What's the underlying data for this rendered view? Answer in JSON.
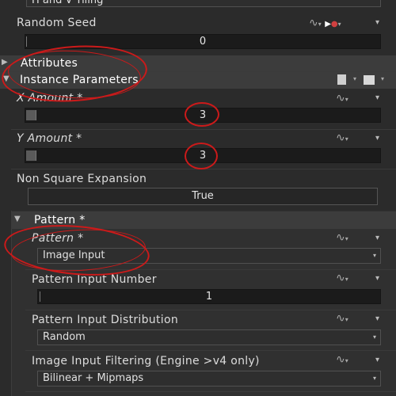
{
  "top_dropdown": {
    "value": "H and V Tiling"
  },
  "random_seed": {
    "label": "Random Seed",
    "value": "0"
  },
  "sections": {
    "attributes": "Attributes",
    "instance_parameters": "Instance Parameters"
  },
  "x_amount": {
    "label": "X Amount *",
    "value": "3"
  },
  "y_amount": {
    "label": "Y Amount *",
    "value": "3"
  },
  "non_square": {
    "label": "Non Square Expansion",
    "value": "True"
  },
  "pattern_group": {
    "title": "Pattern *",
    "pattern": {
      "label": "Pattern *",
      "value": "Image Input"
    },
    "pattern_input_number": {
      "label": "Pattern Input Number",
      "value": "1"
    },
    "pattern_input_distribution": {
      "label": "Pattern Input Distribution",
      "value": "Random"
    },
    "image_input_filtering": {
      "label": "Image Input Filtering (Engine >v4 only)",
      "value": "Bilinear + Mipmaps"
    }
  },
  "icons": {
    "function_icon": "curve-function-icon",
    "play_icon": "play-icon",
    "record_icon": "record-dot-icon",
    "page_icon": "page-icon",
    "list_icon": "list-icon"
  },
  "colors": {
    "annotation": "#cc1a1a",
    "background": "#2b2b2b",
    "section_bar": "#3c3c3c"
  }
}
